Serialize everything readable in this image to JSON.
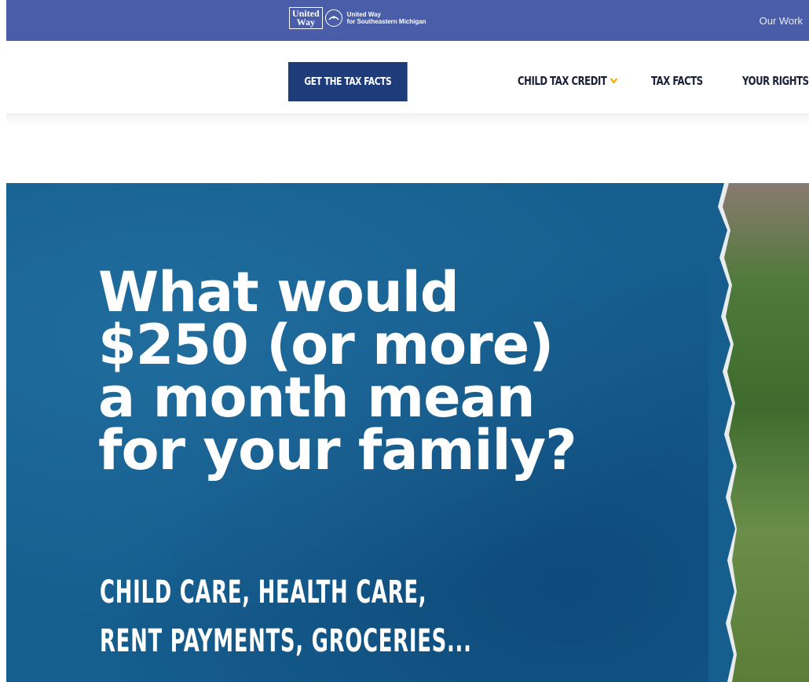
{
  "header": {
    "logo_word_line1": "United",
    "logo_word_line2": "Way",
    "org_line1": "United Way",
    "org_line2": "for Southeastern Michigan",
    "top_link": "Our Work"
  },
  "nav": {
    "cta_label": "GET THE TAX FACTS",
    "items": [
      {
        "label": "CHILD TAX CREDIT"
      },
      {
        "label": "TAX FACTS"
      },
      {
        "label": "YOUR RIGHTS"
      }
    ]
  },
  "hero": {
    "headline_lines": [
      "What would",
      "$250 (or more)",
      "a month mean",
      "for your family?"
    ],
    "sub_lines": [
      "CHILD CARE, HEALTH CARE,",
      "RENT PAYMENTS, GROCERIES..."
    ]
  },
  "colors": {
    "topbar": "#4a5da8",
    "cta": "#1e3b7a",
    "accent_chevron": "#f2a80c",
    "hero_blue": "#155e8e"
  },
  "icons": {
    "logo_emblem": "united-way-emblem-icon",
    "dropdown": "chevron-down-icon"
  }
}
